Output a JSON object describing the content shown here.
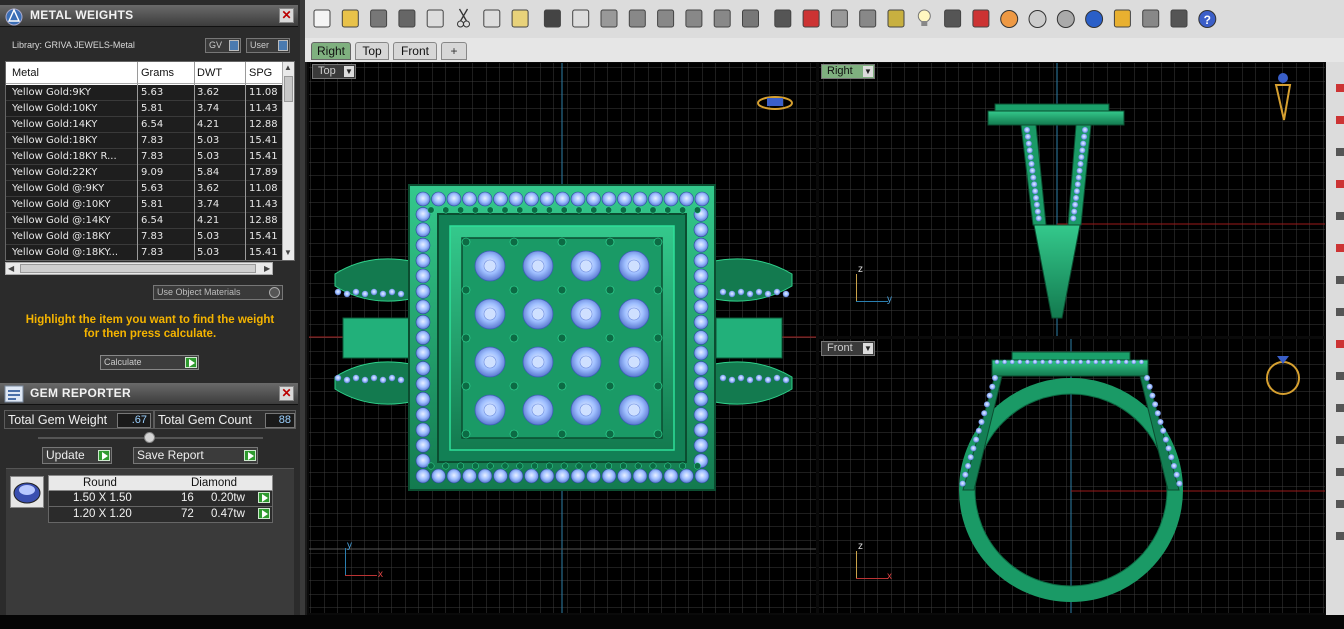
{
  "metal_panel": {
    "title": "METAL WEIGHTS",
    "library_label": "Library: GRIVA JEWELS-Metal",
    "gv_label": "GV",
    "user_label": "User",
    "columns": [
      "Metal",
      "Grams",
      "DWT",
      "SPG"
    ],
    "rows": [
      [
        "Yellow Gold:9KY",
        "5.63",
        "3.62",
        "11.08"
      ],
      [
        "Yellow Gold:10KY",
        "5.81",
        "3.74",
        "11.43"
      ],
      [
        "Yellow Gold:14KY",
        "6.54",
        "4.21",
        "12.88"
      ],
      [
        "Yellow Gold:18KY",
        "7.83",
        "5.03",
        "15.41"
      ],
      [
        "Yellow Gold:18KY R...",
        "7.83",
        "5.03",
        "15.41"
      ],
      [
        "Yellow Gold:22KY",
        "9.09",
        "5.84",
        "17.89"
      ],
      [
        "Yellow Gold @:9KY",
        "5.63",
        "3.62",
        "11.08"
      ],
      [
        "Yellow Gold @:10KY",
        "5.81",
        "3.74",
        "11.43"
      ],
      [
        "Yellow Gold @:14KY",
        "6.54",
        "4.21",
        "12.88"
      ],
      [
        "Yellow Gold @:18KY",
        "7.83",
        "5.03",
        "15.41"
      ],
      [
        "Yellow Gold @:18KY...",
        "7.83",
        "5.03",
        "15.41"
      ]
    ],
    "use_object_materials": "Use Object Materials",
    "hint_line1": "Highlight the item you want to find the weight",
    "hint_line2": "for then press calculate.",
    "calculate_label": "Calculate"
  },
  "gem_panel": {
    "title": "GEM REPORTER",
    "total_weight_label": "Total Gem Weight",
    "total_weight_value": ".67",
    "total_count_label": "Total Gem Count",
    "total_count_value": "88",
    "update_label": "Update",
    "save_report_label": "Save Report",
    "table_header": [
      "Round",
      "Diamond"
    ],
    "rows": [
      [
        "1.50 X 1.50",
        "16",
        "0.20tw"
      ],
      [
        "1.20 X 1.20",
        "72",
        "0.47tw"
      ]
    ]
  },
  "toolbar": {
    "icons": [
      "new-icon",
      "open-icon",
      "save-icon",
      "print-icon",
      "export-icon",
      "cut-icon",
      "copy-icon",
      "paste-icon",
      "undo-icon",
      "pan-hand-icon",
      "move-icon",
      "zoom-icon",
      "zoom-window-icon",
      "zoom-extents-icon",
      "zoom-selected-icon",
      "rotate-view-icon",
      "four-viewports-icon",
      "car-icon",
      "plane-icon",
      "snap-icon",
      "point-icon",
      "light-bulb-icon",
      "lock-icon",
      "layer-icon",
      "color-wheel-icon",
      "render-sphere-icon",
      "shaded-sphere-icon",
      "blue-sphere-icon",
      "triangle-flag-icon",
      "settings-gear-icon",
      "dimension-icon",
      "help-icon"
    ]
  },
  "tabs": [
    "Right",
    "Top",
    "Front"
  ],
  "add_tab": "+",
  "viewports": {
    "top": {
      "label": "Top",
      "x_axis": "x",
      "y_axis": "y"
    },
    "right": {
      "label": "Right",
      "z_axis": "z",
      "y_axis": "y"
    },
    "front": {
      "label": "Front",
      "z_axis": "z",
      "x_axis": "x"
    }
  },
  "colors": {
    "ring_green": "#1f9e6a",
    "gem_blue": "#8fb4ff",
    "grid_line": "#3a3a3a",
    "accent_amber": "#f5b400"
  }
}
